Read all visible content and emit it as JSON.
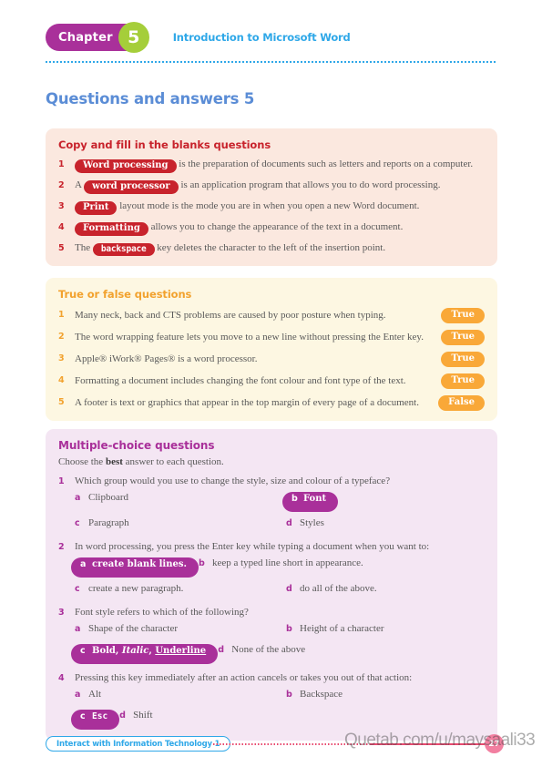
{
  "header": {
    "chapter_label": "Chapter",
    "chapter_number": "5",
    "chapter_title": "Introduction to Microsoft Word"
  },
  "page_heading": "Questions and answers 5",
  "fill_blanks": {
    "title": "Copy and fill in the blanks questions",
    "items": [
      {
        "num": "1",
        "answer": "Word processing",
        "answer_style": "serif",
        "before": "",
        "after": "is the preparation of documents such as letters and reports on a computer."
      },
      {
        "num": "2",
        "answer": "word processor",
        "answer_style": "serif",
        "before": "A",
        "after": "is an application program that allows you to do word processing."
      },
      {
        "num": "3",
        "answer": "Print",
        "answer_style": "serif",
        "before": "",
        "after": "layout mode is the mode you are in when you open a new Word document."
      },
      {
        "num": "4",
        "answer": "Formatting",
        "answer_style": "serif",
        "before": "",
        "after": "allows you to change the appearance of the text in a document."
      },
      {
        "num": "5",
        "answer": "backspace",
        "answer_style": "mono",
        "before": "The",
        "after": "key deletes the character to the left of the insertion point."
      }
    ]
  },
  "true_false": {
    "title": "True or false questions",
    "items": [
      {
        "num": "1",
        "statement": "Many neck, back and CTS problems are caused by poor posture when typing.",
        "answer": "True"
      },
      {
        "num": "2",
        "statement": "The word wrapping feature lets you move to a new line without pressing the Enter key.",
        "answer": "True"
      },
      {
        "num": "3",
        "statement": "Apple® iWork® Pages® is a word processor.",
        "answer": "True"
      },
      {
        "num": "4",
        "statement": "Formatting a document includes changing the font colour and font type of the text.",
        "answer": "True"
      },
      {
        "num": "5",
        "statement": "A footer is text or graphics that appear in the top margin of every page of a document.",
        "answer": "False"
      }
    ]
  },
  "multiple_choice": {
    "title": "Multiple-choice questions",
    "intro_before": "Choose the ",
    "intro_bold": "best",
    "intro_after": " answer to each question.",
    "questions": [
      {
        "num": "1",
        "text": "Which group would you use to change the style, size and colour of a typeface?",
        "options": [
          {
            "letter": "a",
            "label": "Clipboard",
            "selected": false
          },
          {
            "letter": "b",
            "label": "Font",
            "selected": true
          },
          {
            "letter": "c",
            "label": "Paragraph",
            "selected": false
          },
          {
            "letter": "d",
            "label": "Styles",
            "selected": false
          }
        ]
      },
      {
        "num": "2",
        "text": "In word processing, you press the Enter key while typing a document when you want to:",
        "options": [
          {
            "letter": "a",
            "label": "create blank lines.",
            "selected": true
          },
          {
            "letter": "b",
            "label": "keep a typed line short in appearance.",
            "selected": false
          },
          {
            "letter": "c",
            "label": "create a new paragraph.",
            "selected": false
          },
          {
            "letter": "d",
            "label": "do all of the above.",
            "selected": false
          }
        ]
      },
      {
        "num": "3",
        "text": "Font style refers to which of the following?",
        "options": [
          {
            "letter": "a",
            "label": "Shape of the character",
            "selected": false
          },
          {
            "letter": "b",
            "label": "Height of a character",
            "selected": false
          },
          {
            "letter": "c",
            "label": "Bold, Italic, Underline",
            "selected": true,
            "rich": true
          },
          {
            "letter": "d",
            "label": "None of the above",
            "selected": false
          }
        ]
      },
      {
        "num": "4",
        "text": "Pressing this key immediately after an action cancels or takes you out of that action:",
        "options": [
          {
            "letter": "a",
            "label": "Alt",
            "selected": false
          },
          {
            "letter": "b",
            "label": "Backspace",
            "selected": false
          },
          {
            "letter": "c",
            "label": "Esc",
            "selected": true,
            "mono": true
          },
          {
            "letter": "d",
            "label": "Shift",
            "selected": false
          }
        ]
      }
    ]
  },
  "footer": {
    "book_title": "Interact with Information Technology 1",
    "page_number": "27"
  },
  "watermark": "Quetab.com/u/maysaali33",
  "colors": {
    "red": "#C8232C",
    "orange": "#F9A838",
    "purple": "#A9309A",
    "blue": "#2FA8E8",
    "heading_blue": "#5B8DD6",
    "green": "#A5CE3A",
    "pink": "#E8496F"
  }
}
